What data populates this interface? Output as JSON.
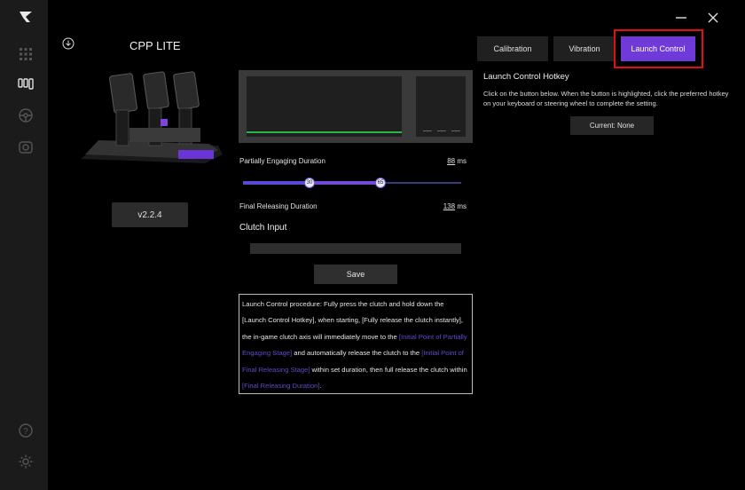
{
  "product": {
    "title": "CPP LITE",
    "version": "v2.2.4"
  },
  "sliders": {
    "partial": {
      "label": "Partially Engaging Duration",
      "value": "88",
      "unit": "ms"
    },
    "final": {
      "label": "Final Releasing Duration",
      "value": "138",
      "unit": "ms"
    },
    "knob1": "30",
    "knob2": "65"
  },
  "clutch": {
    "title": "Clutch Input",
    "save_label": "Save"
  },
  "procedure": {
    "p1": "Launch Control procedure: Fully press the clutch and hold down the [Launch Control Hotkey], when starting, [Fully release the clutch instantly], the in-game clutch axis will immediately move to the ",
    "h1": "[Initial Point of Partially Engaging Stage]",
    "p2": " and automatically release the clutch to the ",
    "h2": "[Initial Point of Final Releasing Stage]",
    "p3": " within set duration, then full release the clutch within ",
    "h3": "[Final Releasing Duration]",
    "p4": "."
  },
  "tabs": {
    "calibration": "Calibration",
    "vibration": "Vibration",
    "launch": "Launch Control"
  },
  "hotkey": {
    "title": "Launch Control Hotkey",
    "description": "Click on the button below. When the button is highlighted, click the preferred hotkey on your keyboard or steering wheel to complete the setting.",
    "current": "Current: None"
  },
  "icons": {
    "logo": "brand-logo-icon",
    "grid": "grid-icon",
    "pedals": "pedals-icon",
    "steering": "steering-wheel-icon",
    "camera": "camera-icon",
    "help": "help-icon",
    "settings": "gear-icon",
    "download": "download-icon",
    "minimize": "minimize-icon",
    "close": "close-icon"
  },
  "colors": {
    "accent": "#6f3ad8",
    "highlight_text": "#5d4cc9",
    "graph_line": "#2db34a",
    "outline": "#e01010"
  }
}
